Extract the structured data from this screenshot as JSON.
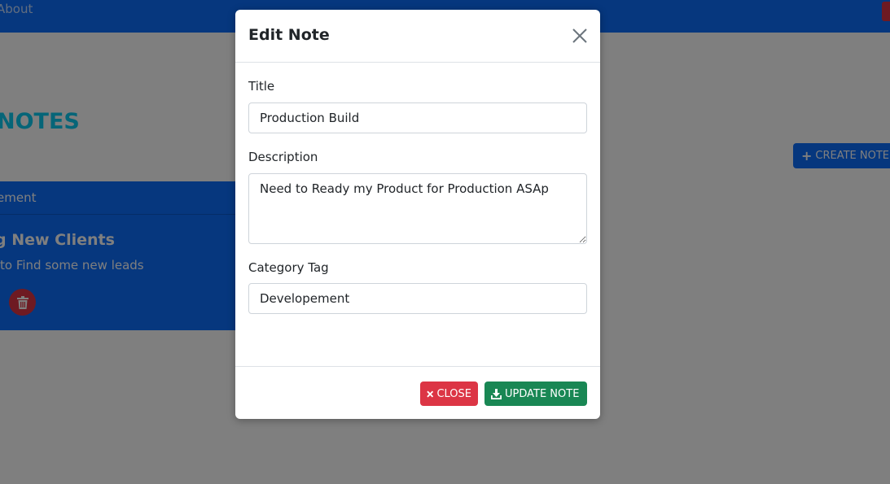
{
  "navbar": {
    "about_label": "About"
  },
  "page": {
    "title": "NOTES",
    "create_button_label": "CREATE NOTE"
  },
  "note_card": {
    "tag": "ement",
    "title": "g New Clients",
    "description": "to Find some new leads"
  },
  "modal": {
    "title": "Edit Note",
    "fields": {
      "title_label": "Title",
      "title_value": "Production Build",
      "description_label": "Description",
      "description_value": "Need to Ready my Product for Production ASAp",
      "category_label": "Category Tag",
      "category_value": "Developement"
    },
    "footer": {
      "close_label": "CLOSE",
      "update_label": "UPDATE NOTE"
    }
  },
  "colors": {
    "primary": "#0d6efd",
    "danger": "#dc3545",
    "success": "#198754",
    "info": "#0dcaf0"
  },
  "icons": [
    "plus-icon",
    "trash-icon",
    "close-icon",
    "times-icon",
    "download-icon"
  ]
}
